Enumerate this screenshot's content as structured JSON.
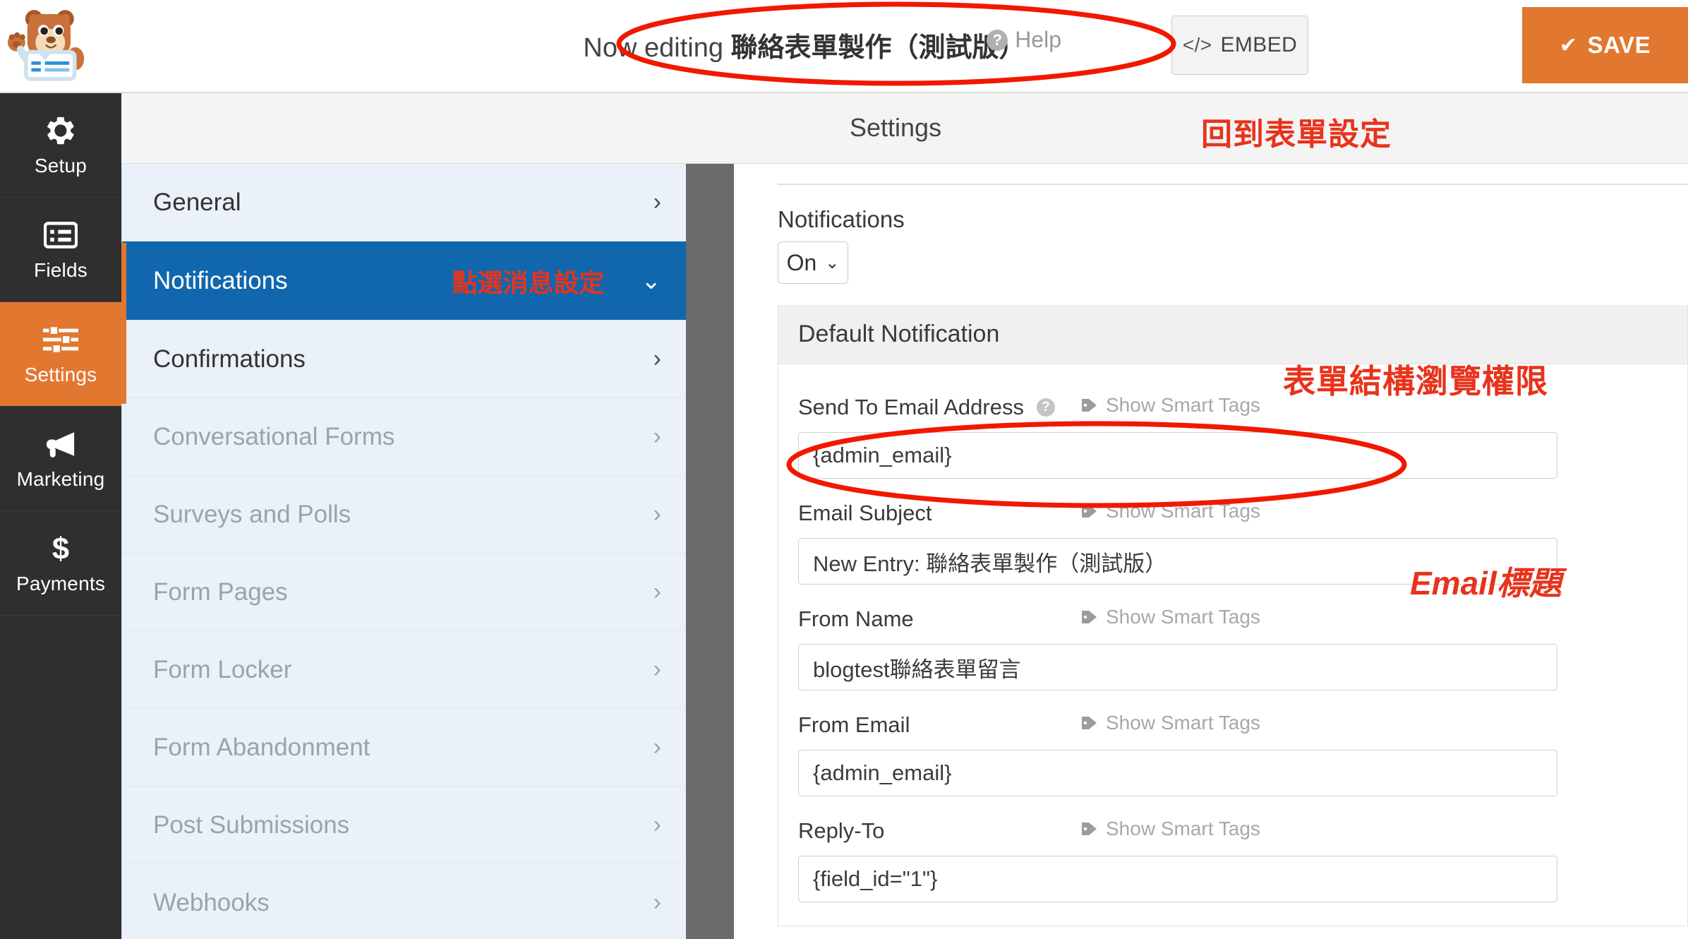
{
  "topbar": {
    "logo_name": "wpforms-bear-logo",
    "editing_prefix": "Now editing ",
    "form_name": "聯絡表單製作（測試版）",
    "help_label": "Help",
    "embed_label": "EMBED",
    "embed_glyph": "</>",
    "save_label": "SAVE",
    "save_glyph": "✔",
    "save_color": "#e27730"
  },
  "rail": {
    "items": [
      {
        "label": "Setup",
        "icon": "gear-icon",
        "active": false
      },
      {
        "label": "Fields",
        "icon": "list-icon",
        "active": false
      },
      {
        "label": "Settings",
        "icon": "sliders-icon",
        "active": true
      },
      {
        "label": "Marketing",
        "icon": "megaphone-icon",
        "active": false
      },
      {
        "label": "Payments",
        "icon": "dollar-icon",
        "active": false
      }
    ],
    "active_color": "#e27730",
    "background": "#2f2f2f"
  },
  "menu": {
    "items": [
      {
        "label": "General",
        "state": "normal",
        "chevron": "›"
      },
      {
        "label": "Notifications",
        "state": "active",
        "chevron": "⌄",
        "note": "點選消息設定"
      },
      {
        "label": "Confirmations",
        "state": "normal",
        "chevron": "›"
      },
      {
        "label": "Conversational Forms",
        "state": "disabled",
        "chevron": "›"
      },
      {
        "label": "Surveys and Polls",
        "state": "disabled",
        "chevron": "›"
      },
      {
        "label": "Form Pages",
        "state": "disabled",
        "chevron": "›"
      },
      {
        "label": "Form Locker",
        "state": "disabled",
        "chevron": "›"
      },
      {
        "label": "Form Abandonment",
        "state": "disabled",
        "chevron": "›"
      },
      {
        "label": "Post Submissions",
        "state": "disabled",
        "chevron": "›"
      },
      {
        "label": "Webhooks",
        "state": "disabled",
        "chevron": "›"
      }
    ],
    "active_color": "#1167ad",
    "background": "#eaf1f9"
  },
  "content": {
    "header_title": "Settings",
    "header_note": "回到表單設定",
    "notifications_label": "Notifications",
    "notifications_toggle_value": "On",
    "toggle_chevron": "⌄",
    "card_title": "Default Notification",
    "smart_tags_label": "Show Smart Tags",
    "fields": [
      {
        "label": "Send To Email Address",
        "value": "{admin_email}",
        "has_help": true,
        "smart_tags": true
      },
      {
        "label": "Email Subject",
        "value": "New Entry: 聯絡表單製作（測試版）",
        "has_help": false,
        "smart_tags": true
      },
      {
        "label": "From Name",
        "value": "blogtest聯絡表單留言",
        "has_help": false,
        "smart_tags": true
      },
      {
        "label": "From Email",
        "value": "{admin_email}",
        "has_help": false,
        "smart_tags": true
      },
      {
        "label": "Reply-To",
        "value": "{field_id=\"1\"}",
        "has_help": false,
        "smart_tags": true
      }
    ]
  },
  "annotations": {
    "color": "#e8331c",
    "ellipse_color": "#f11800",
    "right_top": "表單結構瀏覽權限",
    "right_bottom": "Email標題"
  }
}
